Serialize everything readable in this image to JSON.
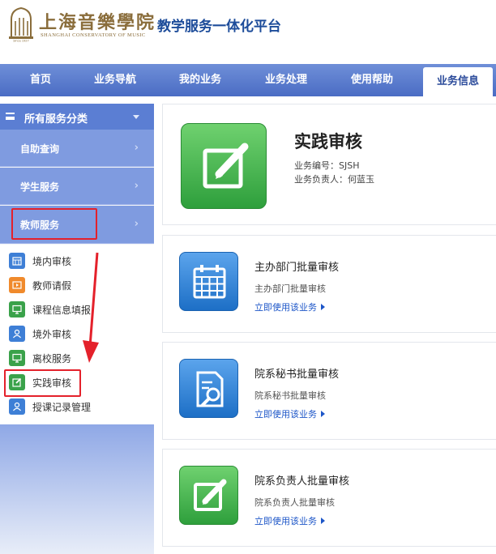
{
  "header": {
    "logo_cn": "上海音樂學院",
    "logo_en": "SHANGHAI CONSERVATORY OF MUSIC",
    "platform_title": "教学服务一体化平台"
  },
  "nav": {
    "items": [
      "首页",
      "业务导航",
      "我的业务",
      "业务处理",
      "使用帮助",
      "业务信息"
    ],
    "active": "业务信息"
  },
  "sidebar": {
    "header": "所有服务分类",
    "categories": [
      "自助查询",
      "学生服务",
      "教师服务"
    ],
    "items": [
      {
        "label": "境内审核",
        "icon": "calendar-icon",
        "color": "#3e7fd6"
      },
      {
        "label": "教师请假",
        "icon": "video-icon",
        "color": "#f08a2c"
      },
      {
        "label": "课程信息填报",
        "icon": "monitor-icon",
        "color": "#3aa24a"
      },
      {
        "label": "境外审核",
        "icon": "user-icon",
        "color": "#3e7fd6"
      },
      {
        "label": "离校服务",
        "icon": "monitor-icon",
        "color": "#3aa24a"
      },
      {
        "label": "实践审核",
        "icon": "edit-icon",
        "color": "#3aa24a"
      },
      {
        "label": "授课记录管理",
        "icon": "user-icon",
        "color": "#3e7fd6"
      }
    ]
  },
  "hero": {
    "title": "实践审核",
    "code_line": "业务编号：SJSH",
    "owner_line": "业务负责人：何蓝玉",
    "icon": "edit-icon"
  },
  "cards": [
    {
      "title": "主办部门批量审核",
      "desc": "主办部门批量审核",
      "link": "立即使用该业务",
      "icon": "calendar-icon",
      "color": "blue"
    },
    {
      "title": "院系秘书批量审核",
      "desc": "院系秘书批量审核",
      "link": "立即使用该业务",
      "icon": "document-search-icon",
      "color": "blue"
    },
    {
      "title": "院系负责人批量审核",
      "desc": "院系负责人批量审核",
      "link": "立即使用该业务",
      "icon": "edit-icon",
      "color": "green"
    }
  ],
  "colors": {
    "nav": "#5a7bd0",
    "sidebar_header": "#5b7ed3",
    "sidebar_category": "#7f9be0",
    "link": "#1d56c8",
    "annotation": "#e4212b"
  }
}
